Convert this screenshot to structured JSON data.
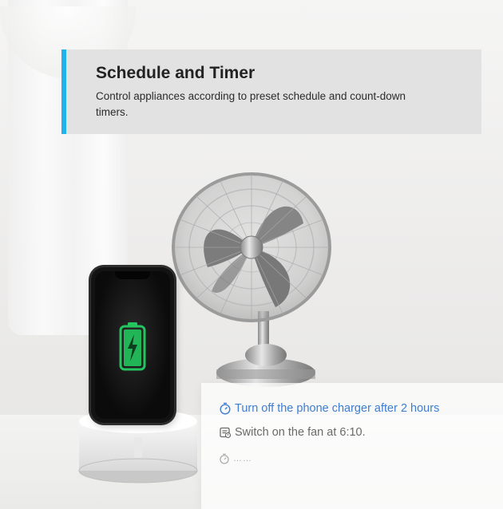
{
  "banner": {
    "title": "Schedule and Timer",
    "description": "Control appliances according to preset schedule and count-down timers.",
    "accent_color": "#20b2ea"
  },
  "tasks": [
    {
      "icon": "timer-icon",
      "text": "Turn off the phone charger after 2 hours",
      "color": "#3e7dd0"
    },
    {
      "icon": "schedule-icon",
      "text": "Switch on the fan at 6:10.",
      "color": "#6a6a6a"
    },
    {
      "icon": "timer-icon",
      "text": "……",
      "color": "#a9a9a9"
    }
  ],
  "visuals": {
    "fan": "desk-fan",
    "phone": "smartphone-charging",
    "battery_color": "#22c55e"
  }
}
